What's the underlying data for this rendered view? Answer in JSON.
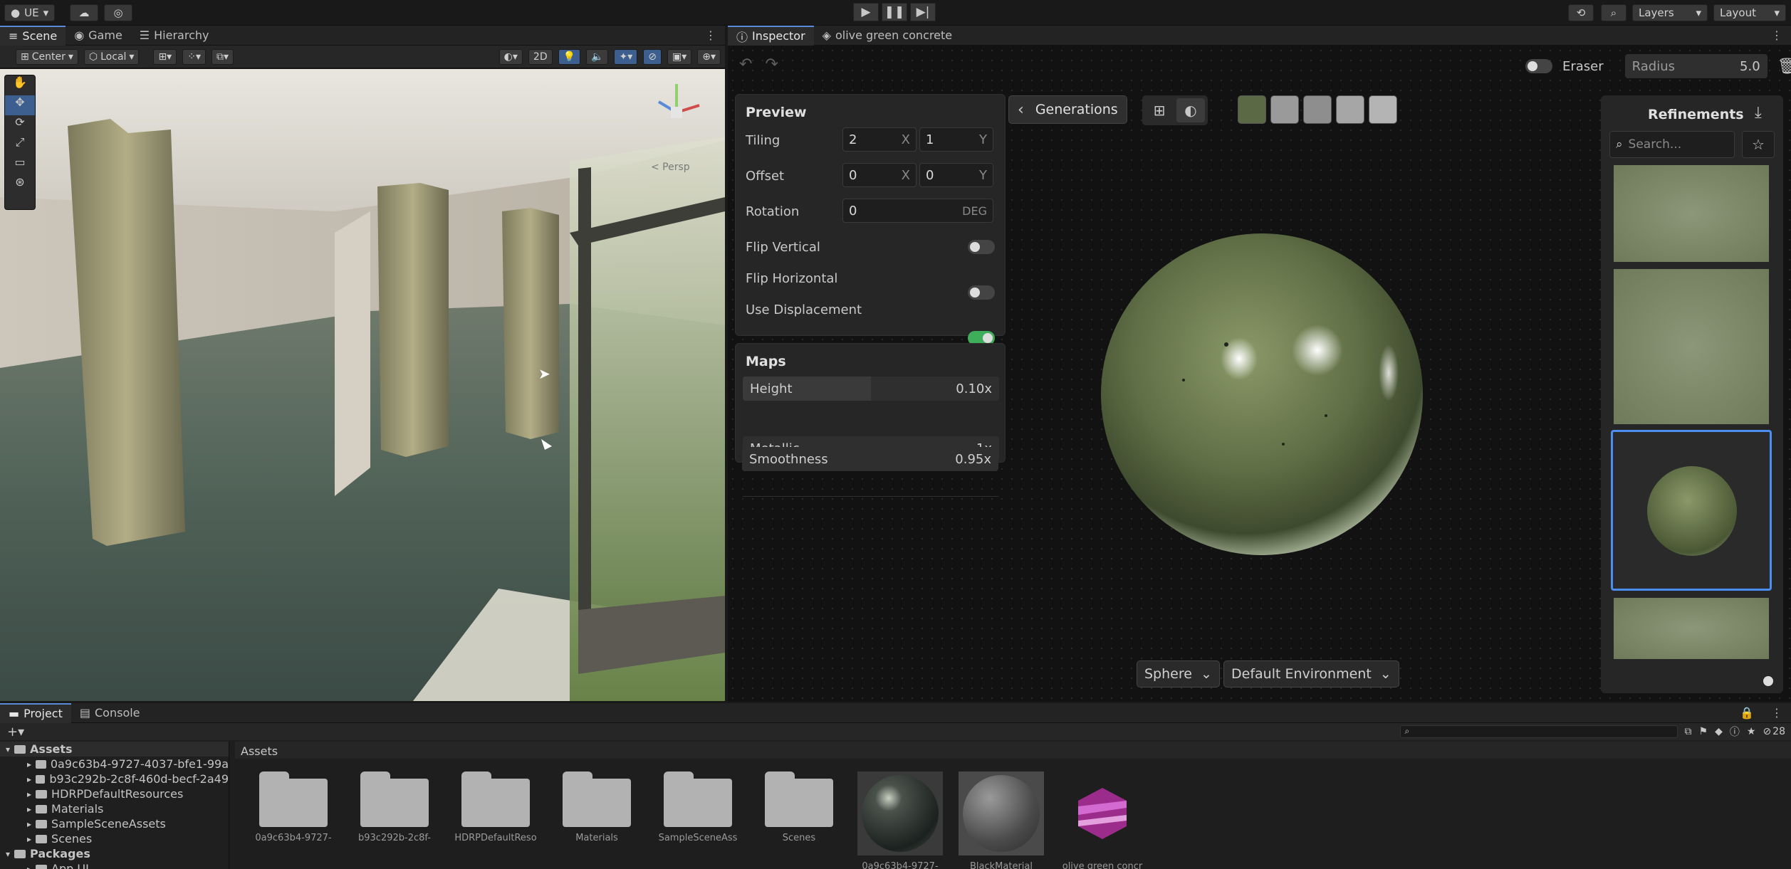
{
  "topbar": {
    "account_label": "UE",
    "layers_label": "Layers",
    "layout_label": "Layout"
  },
  "left_tabs": [
    {
      "label": "Scene"
    },
    {
      "label": "Game"
    },
    {
      "label": "Hierarchy"
    }
  ],
  "scene_toolbar": {
    "pivot_label": "Center",
    "space_label": "Local",
    "mode_2d_label": "2D",
    "persp_label": "< Persp"
  },
  "inspector_tabs": [
    {
      "label": "Inspector"
    },
    {
      "label": "olive green concrete"
    }
  ],
  "eraser": {
    "label": "Eraser",
    "radius_label": "Radius",
    "radius_value": "5.0"
  },
  "preview": {
    "title": "Preview",
    "tiling_label": "Tiling",
    "tiling_x": "2",
    "tiling_y": "1",
    "offset_label": "Offset",
    "offset_x": "0",
    "offset_y": "0",
    "axis_x": "X",
    "axis_y": "Y",
    "rotation_label": "Rotation",
    "rotation_value": "0",
    "rotation_unit": "DEG",
    "flip_vertical_label": "Flip Vertical",
    "flip_horizontal_label": "Flip Horizontal",
    "use_displacement_label": "Use Displacement",
    "flip_vertical": false,
    "flip_horizontal": false,
    "use_displacement": true
  },
  "maps": {
    "title": "Maps",
    "items": [
      {
        "label": "Height",
        "value": "0.10x",
        "fill": 0.5
      },
      {
        "label": "Metallic",
        "value": "1x",
        "fill": 0.0
      },
      {
        "label": "Smoothness",
        "value": "0.95x",
        "fill": 0.0
      }
    ]
  },
  "generations": {
    "back_label": "Generations",
    "swatch_colors": [
      "#5b6a45",
      "#9a9a9a",
      "#8e8e8e",
      "#a6a6a6",
      "#b4b4b4"
    ]
  },
  "preview_footer": {
    "shape_label": "Sphere",
    "environment_label": "Default Environment"
  },
  "refinements": {
    "title": "Refinements",
    "search_placeholder": "Search..."
  },
  "bottom_tabs": [
    {
      "label": "Project"
    },
    {
      "label": "Console"
    }
  ],
  "project": {
    "breadcrumb": "Assets",
    "count_badge": "28",
    "tree": [
      {
        "label": "Assets",
        "level": 0
      },
      {
        "label": "0a9c63b4-9727-4037-bfe1-99a",
        "level": 1
      },
      {
        "label": "b93c292b-2c8f-460d-becf-2a49",
        "level": 1
      },
      {
        "label": "HDRPDefaultResources",
        "level": 1
      },
      {
        "label": "Materials",
        "level": 1
      },
      {
        "label": "SampleSceneAssets",
        "level": 1
      },
      {
        "label": "Scenes",
        "level": 1
      },
      {
        "label": "Packages",
        "level": 0
      },
      {
        "label": "App UI",
        "level": 1
      }
    ],
    "assets": [
      {
        "label": "0a9c63b4-9727-",
        "kind": "folder"
      },
      {
        "label": "b93c292b-2c8f-",
        "kind": "folder"
      },
      {
        "label": "HDRPDefaultReso",
        "kind": "folder"
      },
      {
        "label": "Materials",
        "kind": "folder"
      },
      {
        "label": "SampleSceneAss",
        "kind": "folder"
      },
      {
        "label": "Scenes",
        "kind": "folder"
      },
      {
        "label": "0a9c63b4-9727-",
        "kind": "material-dark"
      },
      {
        "label": "BlackMaterial",
        "kind": "material-grey"
      },
      {
        "label": "olive green concr",
        "kind": "texture"
      }
    ]
  }
}
